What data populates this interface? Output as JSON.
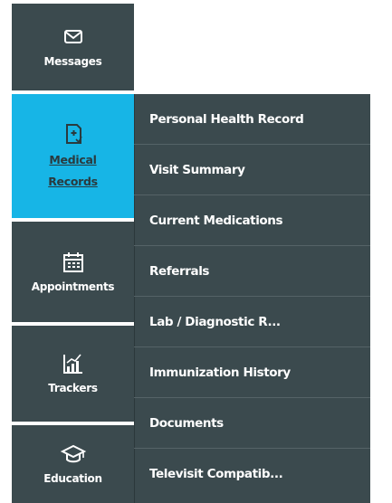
{
  "nav": {
    "items": [
      {
        "label": "Messages",
        "icon": "envelope-icon"
      },
      {
        "label_lines": [
          "Medical",
          "Records"
        ],
        "icon": "medical-record-icon",
        "active": true
      },
      {
        "label": "Appointments",
        "icon": "calendar-icon"
      },
      {
        "label": "Trackers",
        "icon": "chart-icon"
      },
      {
        "label": "Education",
        "icon": "graduation-cap-icon"
      }
    ]
  },
  "submenu": {
    "items": [
      "Personal Health Record",
      "Visit Summary",
      "Current Medications",
      "Referrals",
      "Lab / Diagnostic R...",
      "Immunization History",
      "Documents",
      "Televisit Compatib..."
    ]
  },
  "colors": {
    "panel": "#3b4a4e",
    "active": "#17b5e6",
    "text": "#ffffff"
  }
}
